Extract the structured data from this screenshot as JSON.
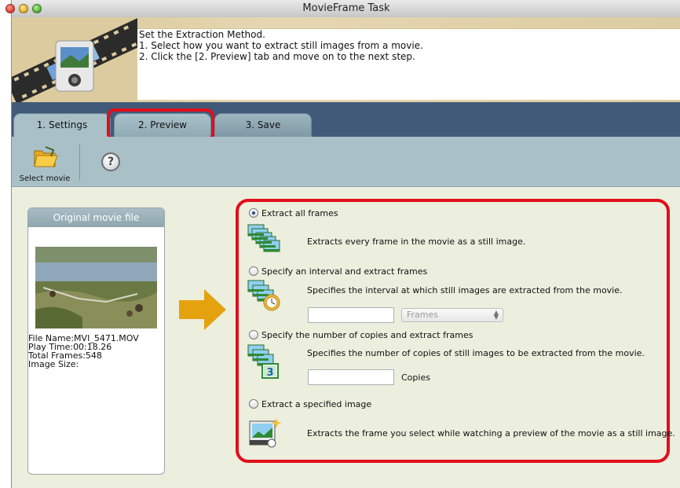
{
  "window": {
    "title": "MovieFrame Task"
  },
  "instructions": {
    "line1": "Set the Extraction Method.",
    "line2": "1. Select how you want to extract still images from a movie.",
    "line3": "2. Click the [2. Preview] tab and move on to the next step."
  },
  "tabs": [
    {
      "label": "1. Settings",
      "active": true
    },
    {
      "label": "2. Preview",
      "active": false,
      "highlighted": true
    },
    {
      "label": "3. Save",
      "active": false
    }
  ],
  "toolbar": {
    "select_movie_label": "Select movie",
    "select_movie_icon": "folder-icon",
    "help_icon": "help-icon",
    "help_glyph": "?"
  },
  "movie_panel": {
    "title": "Original movie file",
    "file_name": "File Name:MVI_5471.MOV",
    "play_time": "Play Time:00:18.26",
    "total_frames": "Total Frames:548",
    "image_size": "Image Size:"
  },
  "options": [
    {
      "label": "Extract all frames",
      "selected": true,
      "description": "Extracts every frame in the movie as a still image.",
      "icon": "all-frames-icon"
    },
    {
      "label": "Specify an interval and extract frames",
      "selected": false,
      "description": "Specifies the interval at which still images are extracted from the movie.",
      "icon": "interval-frames-icon",
      "input_value": "",
      "unit_select": "Frames"
    },
    {
      "label": "Specify the number of copies and extract frames",
      "selected": false,
      "description": "Specifies the number of copies of still images to be extracted from the movie.",
      "icon": "copies-frames-icon",
      "input_value": "",
      "unit_label": "Copies",
      "icon_badge": "3"
    },
    {
      "label": "Extract a specified image",
      "selected": false,
      "description": "Extracts the frame you select while watching a preview of the movie as a still image.",
      "icon": "specified-image-icon"
    }
  ],
  "colors": {
    "highlight": "#e20e1b",
    "tab_strip": "#425a79",
    "toolbar": "#a9c0c7",
    "arrow": "#e5a20f"
  }
}
